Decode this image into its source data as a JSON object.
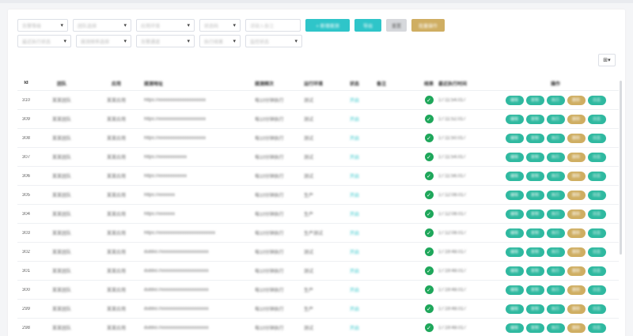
{
  "filters": {
    "row1": [
      {
        "label": "告警等级",
        "type": "select"
      },
      {
        "label": "团队选择",
        "type": "select"
      },
      {
        "label": "应用环境",
        "type": "select"
      },
      {
        "label": "状态码",
        "type": "select"
      },
      {
        "label": "请输入备注",
        "type": "input"
      }
    ],
    "buttons": [
      {
        "label": "+ 新增拨测",
        "style": "teal"
      },
      {
        "label": "导出",
        "style": "teal"
      },
      {
        "label": "重置",
        "style": "gray"
      },
      {
        "label": "批量操作",
        "style": "gold"
      }
    ],
    "row2": [
      {
        "label": "最近执行状态"
      },
      {
        "label": "拨测频率选择"
      },
      {
        "label": "告警通道"
      },
      {
        "label": "执行结果"
      },
      {
        "label": "监控状态"
      }
    ]
  },
  "columns_icon": "columns-grid-icon",
  "table": {
    "headers": [
      "Id",
      "团队",
      "应用",
      "拨测地址",
      "拨测频次",
      "运行环境",
      "状态",
      "备注",
      "结果",
      "最近执行时间",
      "操作"
    ],
    "rows": [
      {
        "id": "310",
        "team": "某某团队",
        "app": "某某应用",
        "url": "https://xxxxxxxxxxxxxxxxxxxx",
        "freq": "每10分钟执行",
        "env": "测试",
        "status": "开启",
        "note": "",
        "time": "17:11:54.017"
      },
      {
        "id": "309",
        "team": "某某团队",
        "app": "某某应用",
        "url": "https://xxxxxxxxxxxxxxxxxxxx",
        "freq": "每10分钟执行",
        "env": "测试",
        "status": "开启",
        "note": "",
        "time": "17:11:52.017"
      },
      {
        "id": "308",
        "team": "某某团队",
        "app": "某某应用",
        "url": "https://xxxxxxxxxxxxxxxxxxxx",
        "freq": "每10分钟执行",
        "env": "测试",
        "status": "开启",
        "note": "",
        "time": "17:11:50.017"
      },
      {
        "id": "307",
        "team": "某某团队",
        "app": "某某应用",
        "url": "https://xxxxxxxxxxxx",
        "freq": "每10分钟执行",
        "env": "测试",
        "status": "开启",
        "note": "",
        "time": "17:11:54.017"
      },
      {
        "id": "306",
        "team": "某某团队",
        "app": "某某应用",
        "url": "https://xxxxxxxxxxxx",
        "freq": "每10分钟执行",
        "env": "测试",
        "status": "开启",
        "note": "",
        "time": "17:11:56.017"
      },
      {
        "id": "305",
        "team": "某某团队",
        "app": "某某应用",
        "url": "https://xxxxxxx",
        "freq": "每10分钟执行",
        "env": "生产",
        "status": "开启",
        "note": "",
        "time": "17:12:08.017"
      },
      {
        "id": "304",
        "team": "某某团队",
        "app": "某某应用",
        "url": "https://xxxxxxx",
        "freq": "每10分钟执行",
        "env": "生产",
        "status": "开启",
        "note": "",
        "time": "17:12:08.017"
      },
      {
        "id": "303",
        "team": "某某团队",
        "app": "某某应用",
        "url": "https://xxxxxxxxxxxxxxxxxxxxxxxx",
        "freq": "每10分钟执行",
        "env": "生产测试",
        "status": "开启",
        "note": "",
        "time": "17:12:08.017"
      },
      {
        "id": "302",
        "team": "某某团队",
        "app": "某某应用",
        "url": "dubbo://xxxxxxxxxxxxxxxxxxxx",
        "freq": "每10分钟执行",
        "env": "测试",
        "status": "开启",
        "note": "",
        "time": "17:19:48.017"
      },
      {
        "id": "301",
        "team": "某某团队",
        "app": "某某应用",
        "url": "dubbo://xxxxxxxxxxxxxxxxxxxx",
        "freq": "每10分钟执行",
        "env": "测试",
        "status": "开启",
        "note": "",
        "time": "17:19:48.017"
      },
      {
        "id": "300",
        "team": "某某团队",
        "app": "某某应用",
        "url": "dubbo://xxxxxxxxxxxxxxxxxxxx",
        "freq": "每10分钟执行",
        "env": "生产",
        "status": "开启",
        "note": "",
        "time": "17:19:48.017"
      },
      {
        "id": "299",
        "team": "某某团队",
        "app": "某某应用",
        "url": "dubbo://xxxxxxxxxxxxxxxxxxxx",
        "freq": "每10分钟执行",
        "env": "生产",
        "status": "开启",
        "note": "",
        "time": "17:19:48.017"
      },
      {
        "id": "298",
        "team": "某某团队",
        "app": "某某应用",
        "url": "dubbo://xxxxxxxxxxxxxxxxxxxx",
        "freq": "每10分钟执行",
        "env": "测试",
        "status": "开启",
        "note": "",
        "time": "17:19:48.017"
      }
    ],
    "ops": [
      {
        "label": "编辑",
        "style": "teal"
      },
      {
        "label": "复制",
        "style": "teal"
      },
      {
        "label": "执行",
        "style": "teal"
      },
      {
        "label": "删除",
        "style": "gold"
      },
      {
        "label": "日志",
        "style": "teal"
      }
    ]
  },
  "colors": {
    "teal": "#2fc5c9",
    "op_teal": "#2fb9a0",
    "gold": "#cfae62",
    "ok": "#1fa75b"
  }
}
